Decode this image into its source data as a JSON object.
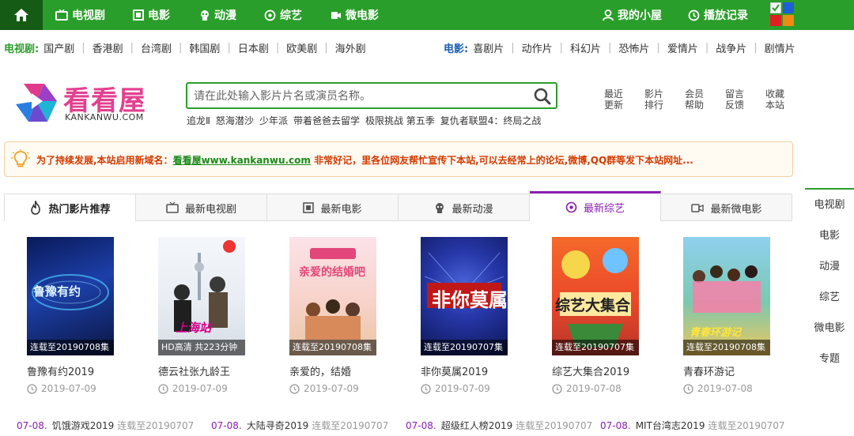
{
  "topnav": {
    "items": [
      {
        "label": "电视剧"
      },
      {
        "label": "电影"
      },
      {
        "label": "动漫"
      },
      {
        "label": "综艺"
      },
      {
        "label": "微电影"
      }
    ],
    "my_home": "我的小屋",
    "history": "播放记录",
    "color": "#2a9e2a"
  },
  "tv_categories": {
    "title": "电视剧:",
    "items": [
      "国产剧",
      "香港剧",
      "台湾剧",
      "韩国剧",
      "日本剧",
      "欧美剧",
      "海外剧"
    ]
  },
  "movie_categories": {
    "title": "电影:",
    "items": [
      "喜剧片",
      "动作片",
      "科幻片",
      "恐怖片",
      "爱情片",
      "战争片",
      "剧情片"
    ]
  },
  "logo": {
    "name": "看看屋",
    "domain": "KANKANWU.COM"
  },
  "search": {
    "placeholder": "请在此处输入影片片名或演员名称。",
    "hot_words": [
      "追龙Ⅱ",
      "怒海潜沙",
      "少年派",
      "带着爸爸去留学",
      "极限挑战 第五季",
      "复仇者联盟4：终局之战"
    ]
  },
  "quick_links": [
    {
      "line1": "最近",
      "line2": "更新"
    },
    {
      "line1": "影片",
      "line2": "排行"
    },
    {
      "line1": "会员",
      "line2": "帮助"
    },
    {
      "line1": "留言",
      "line2": "反馈"
    },
    {
      "line1": "收藏",
      "line2": "本站"
    }
  ],
  "notice": {
    "prefix": "为了持续发展,本站启用新域名：",
    "link": "看看屋www.kankanwu.com",
    "suffix": " 非常好记，里各位网友帮忙宣传下本站,可以去经常上的论坛,微博,QQ群等发下本站网址..."
  },
  "tabs": [
    {
      "label": "热门影片推荐",
      "icon": "flame-icon"
    },
    {
      "label": "最新电视剧",
      "icon": "tv-icon"
    },
    {
      "label": "最新电影",
      "icon": "film-icon"
    },
    {
      "label": "最新动漫",
      "icon": "anime-icon"
    },
    {
      "label": "最新综艺",
      "icon": "target-icon"
    },
    {
      "label": "最新微电影",
      "icon": "camera-icon"
    }
  ],
  "cards": [
    {
      "title": "鲁豫有约2019",
      "date": "2019-07-09",
      "badge": "连载至20190708集",
      "poster_text": "鲁豫有约"
    },
    {
      "title": "德云社张九龄王",
      "date": "2019-07-09",
      "badge": "HD高清 共223分钟",
      "poster_text": "上海站"
    },
    {
      "title": "亲爱的，结婚",
      "date": "2019-07-09",
      "badge": "连载至20190708集",
      "poster_text": "亲爱的结婚吧"
    },
    {
      "title": "非你莫属2019",
      "date": "2019-07-09",
      "badge": "连载至20190707集",
      "poster_text": "非你莫属"
    },
    {
      "title": "综艺大集合2019",
      "date": "2019-07-08",
      "badge": "连载至20190707集",
      "poster_text": "综艺大集合"
    },
    {
      "title": "青春环游记",
      "date": "2019-07-08",
      "badge": "连载至20190708集",
      "poster_text": "青春环游记"
    }
  ],
  "bottom_list": [
    {
      "date": "07-08.",
      "name": "饥饿游戏2019",
      "status": "连载至20190707"
    },
    {
      "date": "07-08.",
      "name": "大陆寻奇2019",
      "status": "连载至20190707"
    },
    {
      "date": "07-08.",
      "name": "超级红人榜2019",
      "status": "连载至20190707"
    },
    {
      "date": "07-08.",
      "name": "MIT台湾志2019",
      "status": "连载至20190707"
    }
  ],
  "side_nav": [
    "电视剧",
    "电影",
    "动漫",
    "综艺",
    "微电影",
    "专题"
  ]
}
